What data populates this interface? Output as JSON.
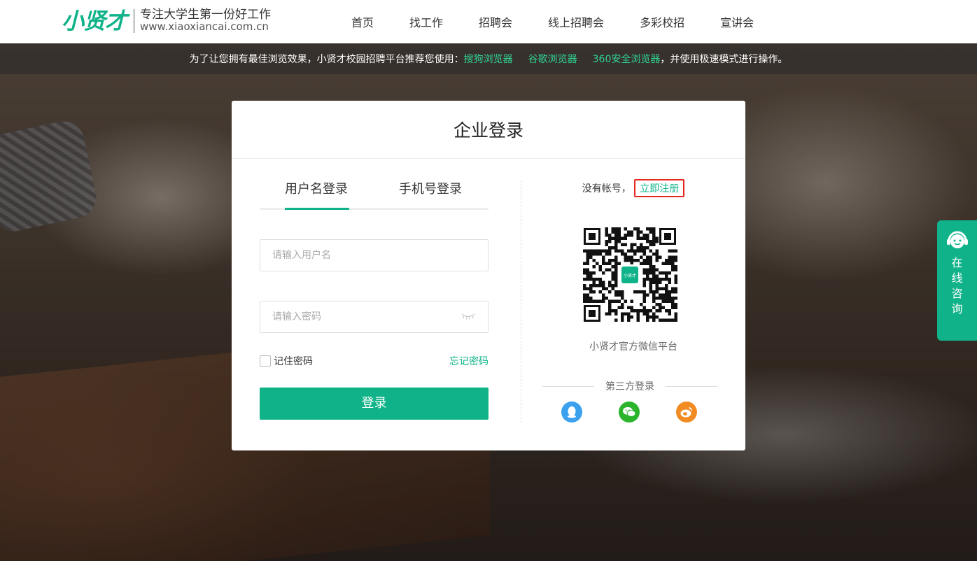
{
  "header": {
    "logo_mark": "小贤才",
    "slogan": "专注大学生第一份好工作",
    "url": "www.xiaoxiancai.com.cn",
    "nav": [
      "首页",
      "找工作",
      "招聘会",
      "线上招聘会",
      "多彩校招",
      "宣讲会"
    ]
  },
  "notice": {
    "prefix": "为了让您拥有最佳浏览效果，小贤才校园招聘平台推荐您使用：",
    "browser1": "搜狗浏览器",
    "browser2": "谷歌浏览器",
    "browser3": "360安全浏览器",
    "suffix": "，并使用极速模式进行操作。"
  },
  "login": {
    "title": "企业登录",
    "tab_username": "用户名登录",
    "tab_phone": "手机号登录",
    "username_placeholder": "请输入用户名",
    "password_placeholder": "请输入密码",
    "remember": "记住密码",
    "forgot": "忘记密码",
    "submit": "登录"
  },
  "side": {
    "no_account": "没有帐号，",
    "register": "立即注册",
    "qr_badge": "小贤才",
    "qr_caption": "小贤才官方微信平台",
    "third_party": "第三方登录"
  },
  "consult": {
    "label": "在线咨询"
  },
  "colors": {
    "accent": "#10b389",
    "highlight_border": "#e4261d",
    "qq": "#3ba0ee",
    "wechat": "#2cb52c",
    "weibo": "#f28b22"
  }
}
